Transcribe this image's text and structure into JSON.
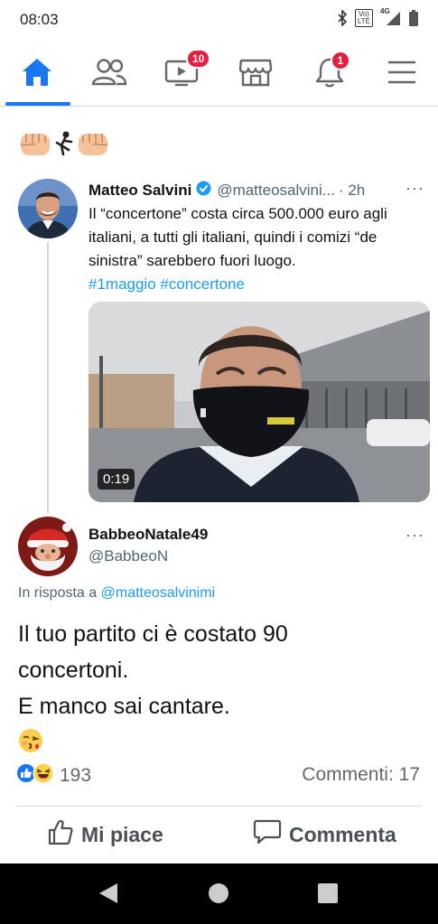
{
  "status_bar": {
    "time": "08:03",
    "volte_top": "Vo)",
    "volte_bottom": "LTE",
    "network": "4G"
  },
  "nav": {
    "items": [
      {
        "name": "home",
        "active": true
      },
      {
        "name": "friends"
      },
      {
        "name": "watch",
        "badge": "10"
      },
      {
        "name": "marketplace"
      },
      {
        "name": "notifications",
        "badge": "1"
      },
      {
        "name": "menu"
      }
    ],
    "accent_color": "#1877f2",
    "badge_color": "#e41e3f"
  },
  "post": {
    "header_emojis": [
      "fist-emoji",
      "kick-emoji",
      "fist-emoji"
    ],
    "tweet": {
      "name": "Matteo Salvini",
      "handle": "@matteosalvini...",
      "time": "· 2h",
      "more": "···",
      "text": "Il “concertone” costa circa 500.000 euro agli italiani, a tutti gli italiani, quindi i comizi “de sinistra” sarebbero fuori luogo.",
      "hashtags": "#1maggio #concertone",
      "video_duration": "0:19"
    },
    "reply": {
      "name": "BabbeoNatale49",
      "handle": "@BabbeoN",
      "more": "···",
      "in_reply_prefix": "In risposta a",
      "in_reply_mention": "@matteosalvinimi",
      "lines": [
        "Il tuo partito ci è costato 90",
        "concertoni.",
        "E manco sai cantare."
      ],
      "emoji": "kiss-emoji"
    },
    "reactions": {
      "types": [
        "like",
        "haha"
      ],
      "count": "193"
    },
    "comments": "Commenti: 17",
    "actions": {
      "like": "Mi piace",
      "comment": "Commenta"
    }
  }
}
